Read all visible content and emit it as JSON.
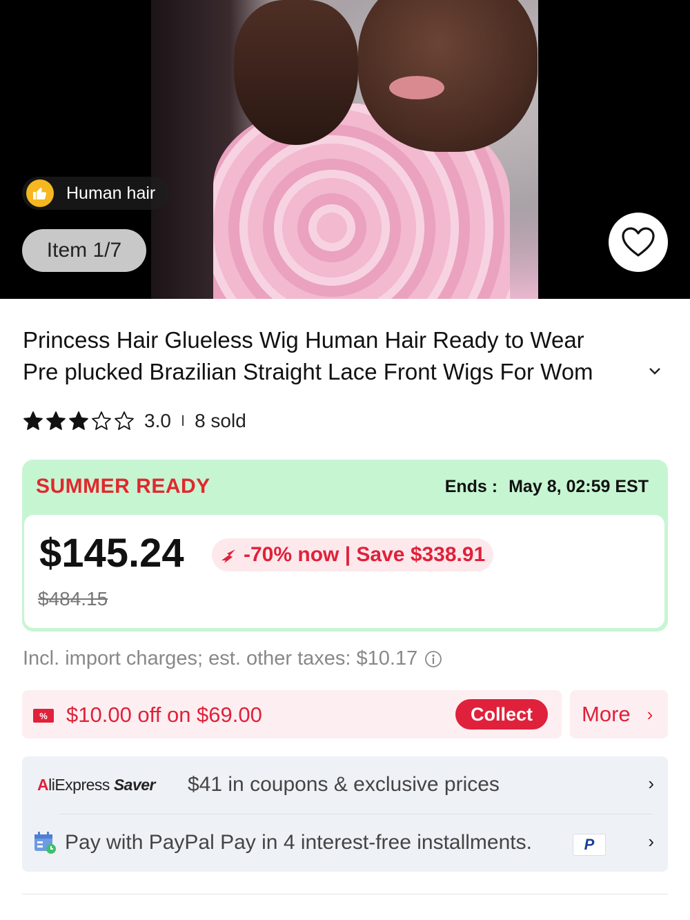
{
  "media": {
    "badge_label": "Human hair",
    "item_counter": "Item 1/7",
    "wishlist_icon": "heart-icon"
  },
  "product": {
    "title_line1": "Princess Hair Glueless Wig Human Hair Ready to Wear",
    "title_line2": "Pre plucked Brazilian Straight Lace Front Wigs For Wom",
    "rating_value": "3.0",
    "rating_stars_filled": 3,
    "rating_stars_total": 5,
    "rating_separator": "I",
    "sold": "8 sold"
  },
  "promo": {
    "label": "SUMMER READY",
    "ends_label": "Ends :",
    "ends_value": "May 8, 02:59 EST",
    "price": "$145.24",
    "discount": "-70% now | Save $338.91",
    "original_price": "$484.15"
  },
  "tax_note": "Incl. import charges; est. other taxes: $10.17",
  "coupon": {
    "icon_text": "%",
    "text": "$10.00 off on $69.00",
    "collect_label": "Collect",
    "more_label": "More",
    "more_arrow": "›"
  },
  "saver": {
    "logo_prefix": "A",
    "logo_mid": "liExpress ",
    "logo_s": "S",
    "logo_suffix": "aver",
    "text": "$41 in coupons & exclusive prices",
    "arrow": "›"
  },
  "paypal": {
    "text": "Pay with PayPal Pay in 4 interest-free installments.",
    "badge": "P",
    "arrow": "›"
  },
  "colors": {
    "accent_red": "#e0213b",
    "promo_green": "#c6f5d2",
    "star_fill": "#111111"
  }
}
